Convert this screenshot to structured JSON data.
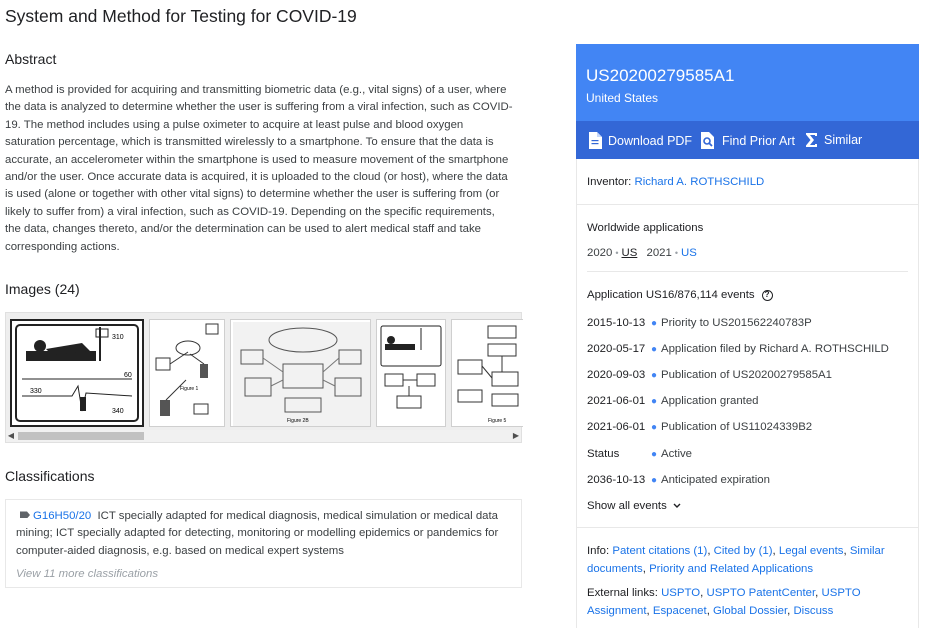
{
  "title": "System and Method for Testing for COVID-19",
  "abstract": {
    "heading": "Abstract",
    "text": "A method is provided for acquiring and transmitting biometric data (e.g., vital signs) of a user, where the data is analyzed to determine whether the user is suffering from a viral infection, such as COVID-19. The method includes using a pulse oximeter to acquire at least pulse and blood oxygen saturation percentage, which is transmitted wirelessly to a smartphone. To ensure that the data is accurate, an accelerometer within the smartphone is used to measure movement of the smartphone and/or the user. Once accurate data is acquired, it is uploaded to the cloud (or host), where the data is used (alone or together with other vital signs) to determine whether the user is suffering from (or likely to suffer from) a viral infection, such as COVID-19. Depending on the specific requirements, the data, changes thereto, and/or the determination can be used to alert medical staff and take corresponding actions."
  },
  "images": {
    "heading": "Images (24)",
    "thumb_labels": [
      "310",
      "330",
      "340",
      "60",
      "Figure 1",
      "Figure 2B",
      "Figure 5"
    ]
  },
  "classifications": {
    "heading": "Classifications",
    "code": "G16H50/20",
    "description": "ICT specially adapted for medical diagnosis, medical simulation or medical data mining; ICT specially adapted for detecting, monitoring or modelling epidemics or pandemics for computer-aided diagnosis, e.g. based on medical expert systems",
    "more": "View 11 more classifications"
  },
  "patent": {
    "number": "US20200279585A1",
    "country": "United States",
    "actions": {
      "download_pdf": "Download PDF",
      "find_prior_art": "Find Prior Art",
      "similar": "Similar"
    }
  },
  "inventor": {
    "label": "Inventor:",
    "name": "Richard A. ROTHSCHILD"
  },
  "worldwide": {
    "heading": "Worldwide applications",
    "year1": "2020",
    "country1": "US",
    "year2": "2021",
    "country2": "US"
  },
  "events": {
    "heading": "Application US16/876,114 events",
    "items": [
      {
        "date": "2015-10-13",
        "desc": "Priority to US201562240783P"
      },
      {
        "date": "2020-05-17",
        "desc": "Application filed by Richard A. ROTHSCHILD"
      },
      {
        "date": "2020-09-03",
        "desc": "Publication of US20200279585A1"
      },
      {
        "date": "2021-06-01",
        "desc": "Application granted"
      },
      {
        "date": "2021-06-01",
        "desc": "Publication of US11024339B2"
      },
      {
        "date": "Status",
        "desc": "Active"
      },
      {
        "date": "2036-10-13",
        "desc": "Anticipated expiration"
      }
    ],
    "show_all": "Show all events"
  },
  "info": {
    "label": "Info:",
    "links": [
      "Patent citations (1)",
      "Cited by (1)",
      "Legal events",
      "Similar documents",
      "Priority and Related Applications"
    ]
  },
  "external": {
    "label": "External links:",
    "links": [
      "USPTO",
      "USPTO PatentCenter",
      "USPTO Assignment",
      "Espacenet",
      "Global Dossier",
      "Discuss"
    ]
  }
}
